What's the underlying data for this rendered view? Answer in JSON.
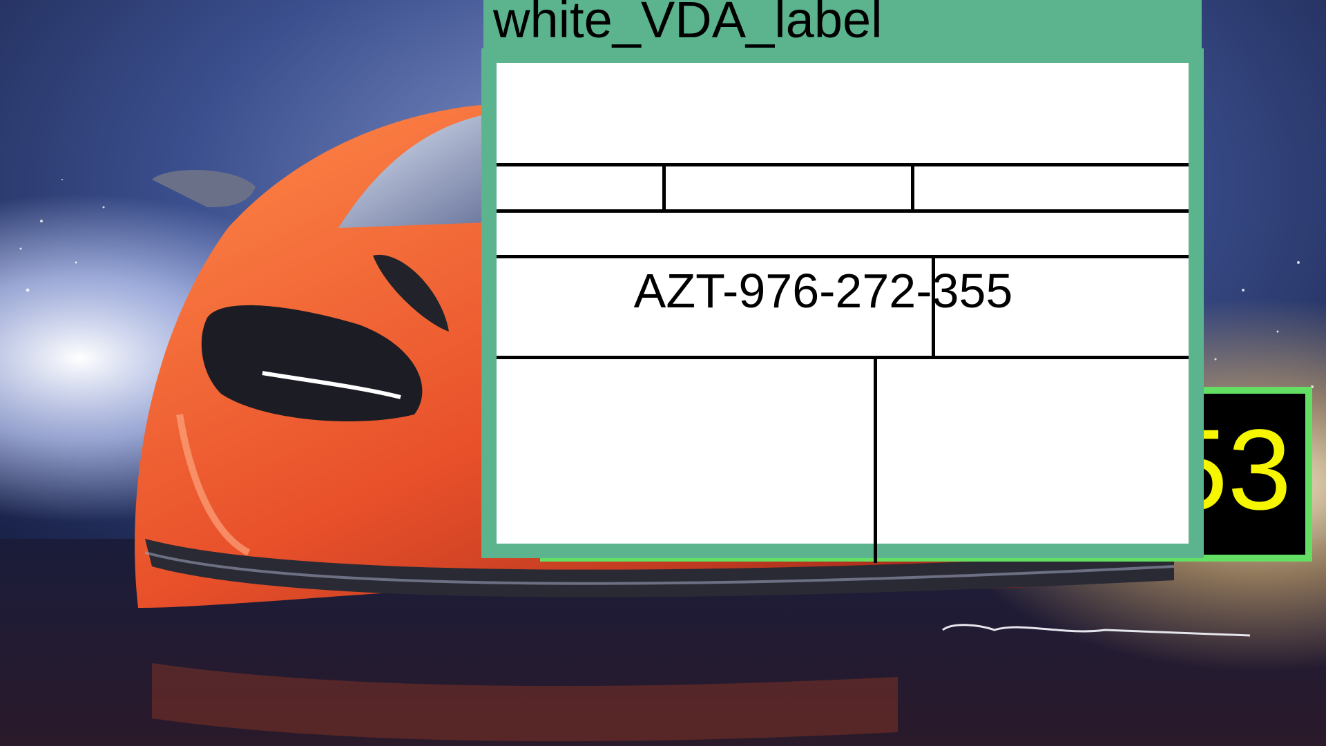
{
  "scene": {
    "description_icon": "sports-car-artwork-icon",
    "colors": {
      "sky_dark": "#101638",
      "sky_mid": "#4a5e98",
      "car_orange": "#f0642a",
      "car_red": "#c8321c",
      "light_white": "#f4f6ff",
      "glow_gold": "#e8c47a"
    }
  },
  "overlay_yellow": {
    "text": "53",
    "text_color": "#f6f600",
    "border_color": "#63e063",
    "background": "#000000"
  },
  "vda_label": {
    "header": "white_VDA_label",
    "header_color": "#5bb48e",
    "code": "AZT-976-272-355"
  }
}
